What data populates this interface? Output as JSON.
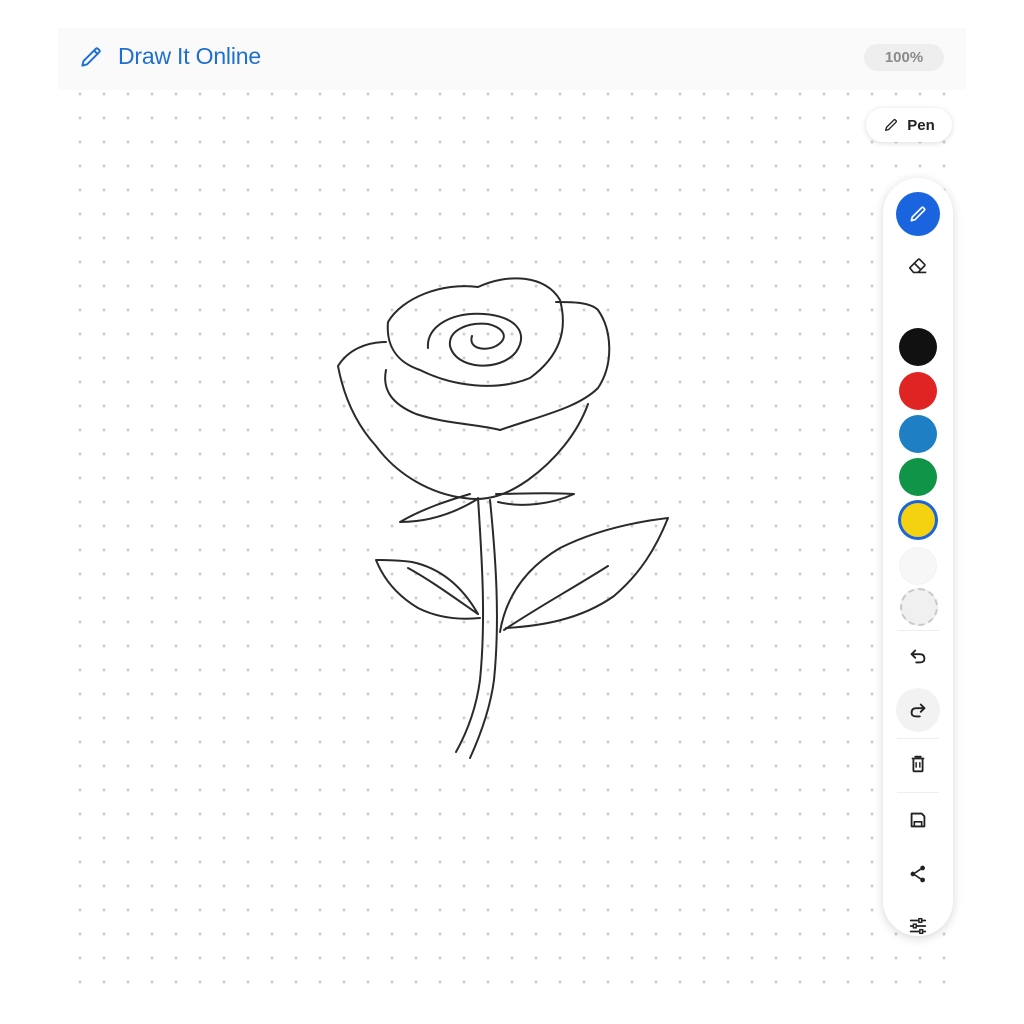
{
  "app": {
    "title": "Draw It Online",
    "zoom": "100%"
  },
  "current_tool": {
    "label": "Pen",
    "icon": "pencil-icon"
  },
  "toolbar": {
    "tools": [
      {
        "name": "pen",
        "icon": "pencil-icon",
        "active": true
      },
      {
        "name": "eraser",
        "icon": "eraser-icon",
        "active": false
      }
    ],
    "colors": [
      {
        "name": "black",
        "hex": "#111111"
      },
      {
        "name": "red",
        "hex": "#e02424"
      },
      {
        "name": "blue",
        "hex": "#1f7fc4"
      },
      {
        "name": "green",
        "hex": "#0f9448"
      },
      {
        "name": "yellow",
        "hex": "#f5d20f",
        "selected": true
      }
    ],
    "actions": [
      "undo-icon",
      "redo-icon",
      "clear-icon",
      "save-icon",
      "share-icon",
      "settings-icon"
    ]
  },
  "accent_color": "#1a64e0"
}
